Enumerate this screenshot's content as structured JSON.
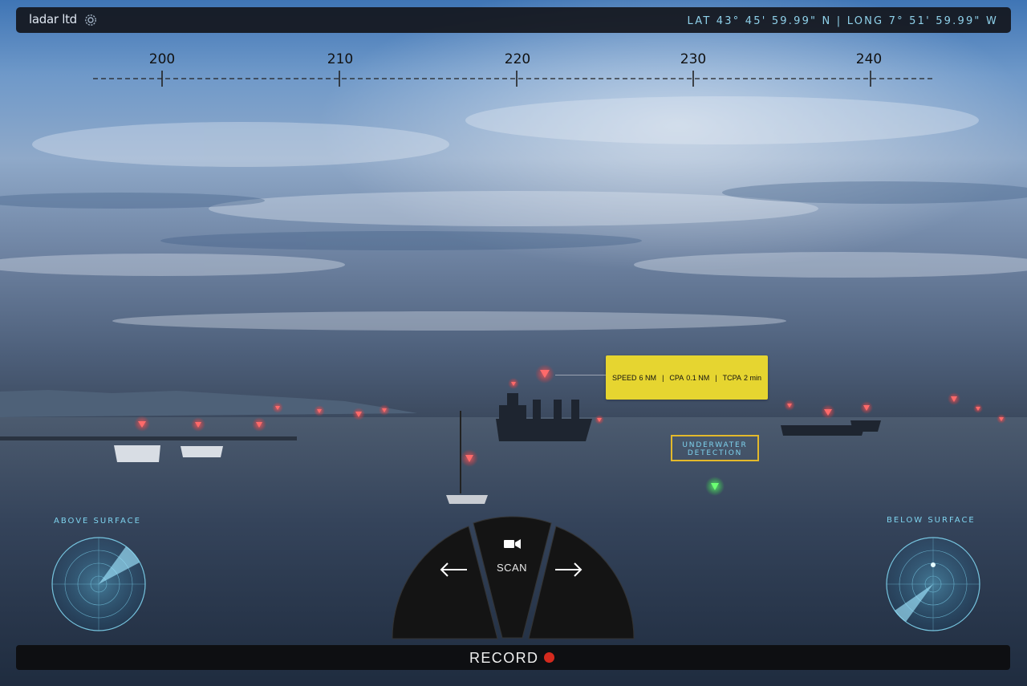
{
  "app": {
    "logo_text": "ladar ltd",
    "settings_icon": "gear-icon"
  },
  "position": {
    "text": "LAT 43° 45' 59.99\" N | LONG 7° 51' 59.99\" W"
  },
  "compass": {
    "ticks": [
      "200",
      "210",
      "220",
      "230",
      "240"
    ]
  },
  "target_info": {
    "speed_label": "SPEED",
    "speed_value": "6 NM",
    "cpa_label": "CPA",
    "cpa_value": "0.1 NM",
    "tcpa_label": "TCPA",
    "tcpa_value": "2 min"
  },
  "underwater": {
    "line1": "UNDERWATER",
    "line2": "DETECTION"
  },
  "sonar": {
    "above_label": "ABOVE SURFACE",
    "below_label": "BELOW SURFACE"
  },
  "controls": {
    "scan_label": "SCAN",
    "left_icon": "arrow-left-icon",
    "right_icon": "arrow-right-icon",
    "camera_icon": "video-camera-icon"
  },
  "record": {
    "label": "RECORD"
  },
  "colors": {
    "accent": "#7ed3ee",
    "tooltip": "#e6d530",
    "marker_red": "#ff5a5a",
    "marker_green": "#5dff6a",
    "record_dot": "#d42a1e"
  }
}
